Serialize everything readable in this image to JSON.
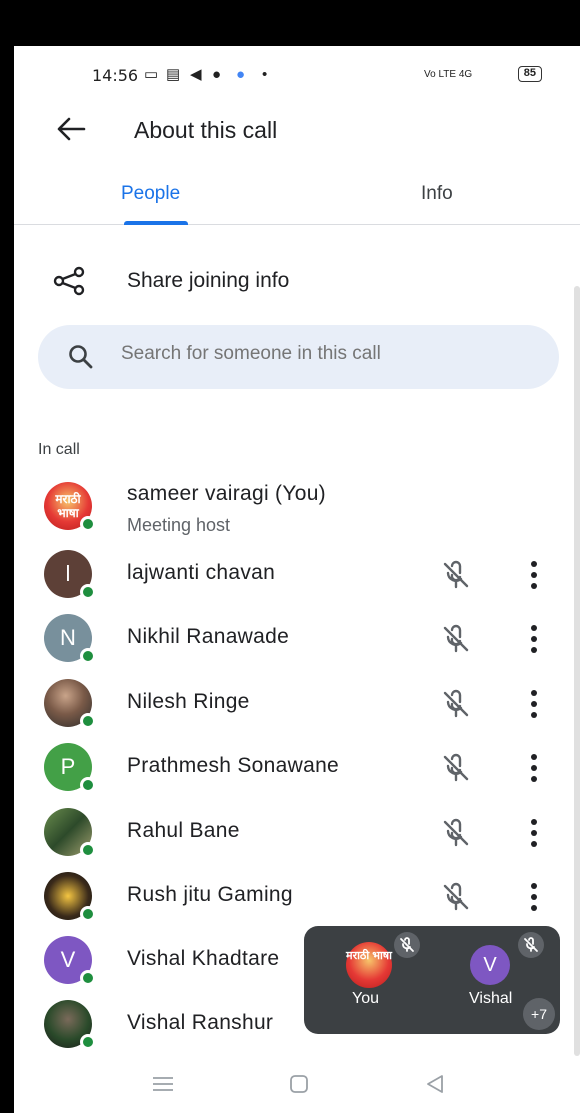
{
  "status_bar": {
    "time": "14:56",
    "network": "Vo LTE 4G",
    "battery": "85"
  },
  "app_bar": {
    "title": "About this call"
  },
  "tabs": [
    {
      "label": "People",
      "active": true
    },
    {
      "label": "Info",
      "active": false
    }
  ],
  "share": {
    "label": "Share joining info"
  },
  "search": {
    "placeholder": "Search for someone in this call"
  },
  "section_label": "In call",
  "participants": [
    {
      "name": "sameer vairagi (You)",
      "subtitle": "Meeting host",
      "avatar": "मराठी भाषा",
      "avatar_color": "#e53935",
      "muted": false
    },
    {
      "name": "lajwanti chavan",
      "avatar": "l",
      "avatar_color": "#5d4037",
      "muted": true
    },
    {
      "name": "Nikhil Ranawade",
      "avatar": "N",
      "avatar_color": "#78909c",
      "muted": true
    },
    {
      "name": "Nilesh Ringe",
      "avatar": "",
      "avatar_color": "#7a5a48",
      "muted": true
    },
    {
      "name": "Prathmesh Sonawane",
      "avatar": "P",
      "avatar_color": "#43a047",
      "muted": true
    },
    {
      "name": "Rahul Bane",
      "avatar": "",
      "avatar_color": "#6b8e4e",
      "muted": true
    },
    {
      "name": "Rush jitu Gaming",
      "avatar": "",
      "avatar_color": "#3a2a1a",
      "muted": true
    },
    {
      "name": "Vishal Khadtare",
      "avatar": "V",
      "avatar_color": "#7e57c2",
      "muted": true
    },
    {
      "name": "Vishal Ranshur",
      "avatar": "",
      "avatar_color": "#2a4a2a",
      "muted": true
    }
  ],
  "floating_panel": {
    "tiles": [
      {
        "label": "You",
        "avatar": "मराठी भाषा"
      },
      {
        "label": "Vishal",
        "avatar": "V"
      }
    ],
    "more_count": "+7"
  },
  "colors": {
    "accent": "#1a73e8",
    "online": "#1e8e3e",
    "search_bg": "#e8eef8"
  }
}
